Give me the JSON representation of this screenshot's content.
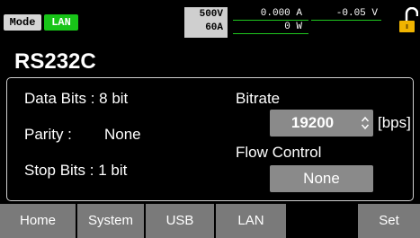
{
  "status": {
    "mode_label": "Mode",
    "lan_label": "LAN",
    "voltage_limit": "500V",
    "current_limit": "60A",
    "measured_current": "0.000 A",
    "measured_voltage": "-0.05 V",
    "measured_power": "0 W",
    "lan_color": "#18c418",
    "lock_color": "#f0b400"
  },
  "page": {
    "title": "RS232C"
  },
  "settings": {
    "data_bits": "Data Bits : 8 bit",
    "parity_label": "Parity :",
    "parity_value": "None",
    "stop_bits": "Stop Bits : 1 bit",
    "bitrate_label": "Bitrate",
    "bitrate_value": "19200",
    "bitrate_unit": "[bps]",
    "flow_control_label": "Flow Control",
    "flow_control_value": "None"
  },
  "function_keys": [
    "Home",
    "System",
    "USB",
    "LAN",
    "",
    "Set"
  ]
}
